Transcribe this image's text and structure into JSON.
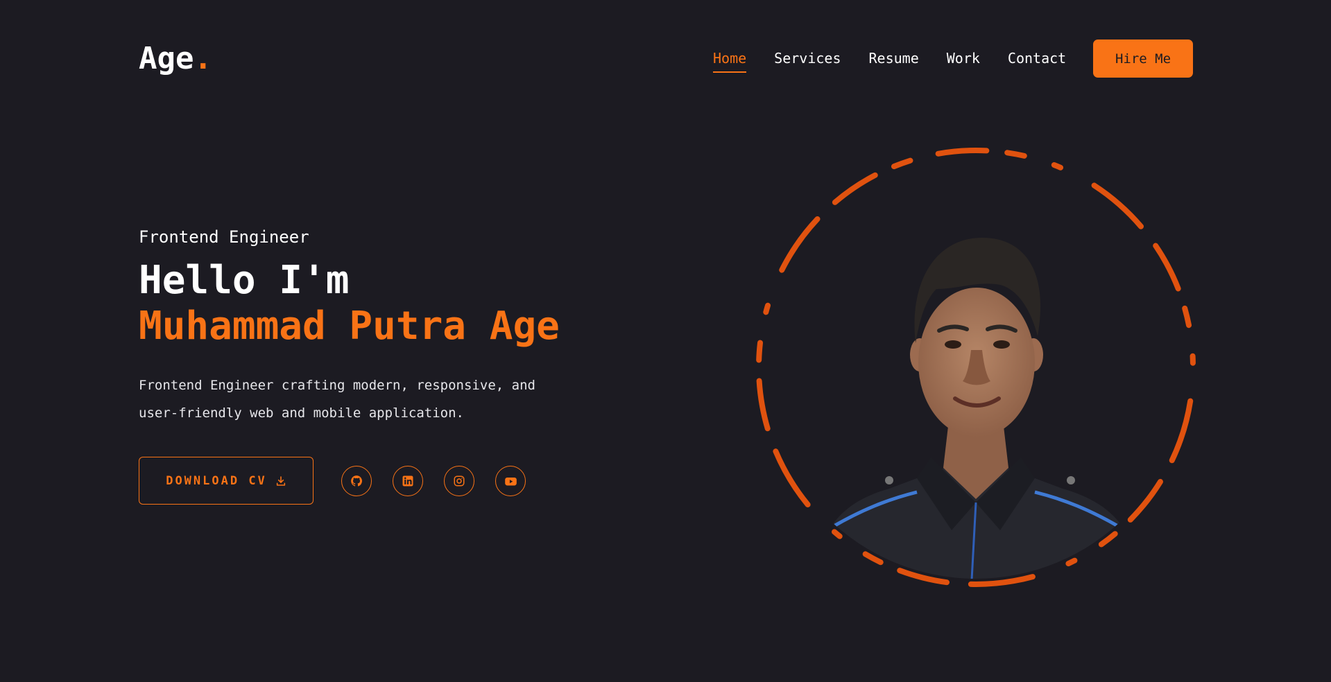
{
  "header": {
    "logo_text": "Age",
    "logo_dot": ".",
    "nav": [
      {
        "label": "Home",
        "active": true
      },
      {
        "label": "Services",
        "active": false
      },
      {
        "label": "Resume",
        "active": false
      },
      {
        "label": "Work",
        "active": false
      },
      {
        "label": "Contact",
        "active": false
      }
    ],
    "hire_label": "Hire Me"
  },
  "hero": {
    "role": "Frontend Engineer",
    "greeting": "Hello I'm",
    "name": "Muhammad Putra Age",
    "description": "Frontend Engineer crafting modern, responsive, and user-friendly web and mobile application.",
    "download_label": "DOWNLOAD CV",
    "download_icon": "download-icon",
    "socials": [
      {
        "icon": "github-icon"
      },
      {
        "icon": "linkedin-icon"
      },
      {
        "icon": "instagram-icon"
      },
      {
        "icon": "youtube-icon"
      }
    ]
  },
  "colors": {
    "background": "#1c1b22",
    "accent": "#f97316",
    "ring": "#e0520f",
    "text": "#ffffff"
  }
}
